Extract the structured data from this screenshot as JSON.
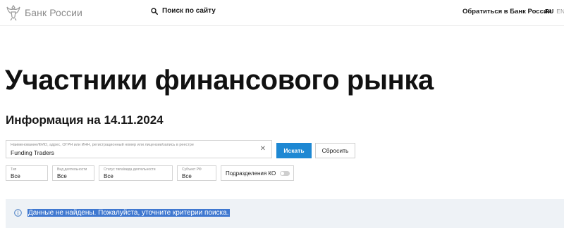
{
  "header": {
    "logo_text": "Банк России",
    "logo_icon": "double-headed-eagle-emblem",
    "search_icon": "search-icon",
    "search_label": "Поиск по сайту",
    "contact_link": "Обратиться в Банк России",
    "languages": [
      {
        "code": "RU",
        "active": true
      },
      {
        "code": "EN",
        "active": false
      }
    ]
  },
  "page": {
    "title": "Участники финансового рынка",
    "info_date": "Информация на 14.11.2024"
  },
  "search_form": {
    "query_label": "Наименование/ФИО, адрес, ОГРН или ИНН, регистрационный номер или лицензии/запись в реестре",
    "query_value": "Funding Traders",
    "clear_icon": "close-icon",
    "submit_label": "Искать",
    "reset_label": "Сбросить"
  },
  "filters": [
    {
      "label": "Тип",
      "value": "Все"
    },
    {
      "label": "Вид деятельности",
      "value": "Все"
    },
    {
      "label": "Статус типа/вида деятельности",
      "value": "Все"
    },
    {
      "label": "Субъект РФ",
      "value": "Все"
    }
  ],
  "toggle": {
    "label": "Подразделения КО",
    "enabled": false
  },
  "notice": {
    "icon": "info-icon",
    "text": "Данные не найдены. Пожалуйста, уточните критерии поиска."
  },
  "colors": {
    "primary_button": "#1e88d3",
    "notice_background": "#eef2f6",
    "text_selection": "#3f78d0"
  }
}
